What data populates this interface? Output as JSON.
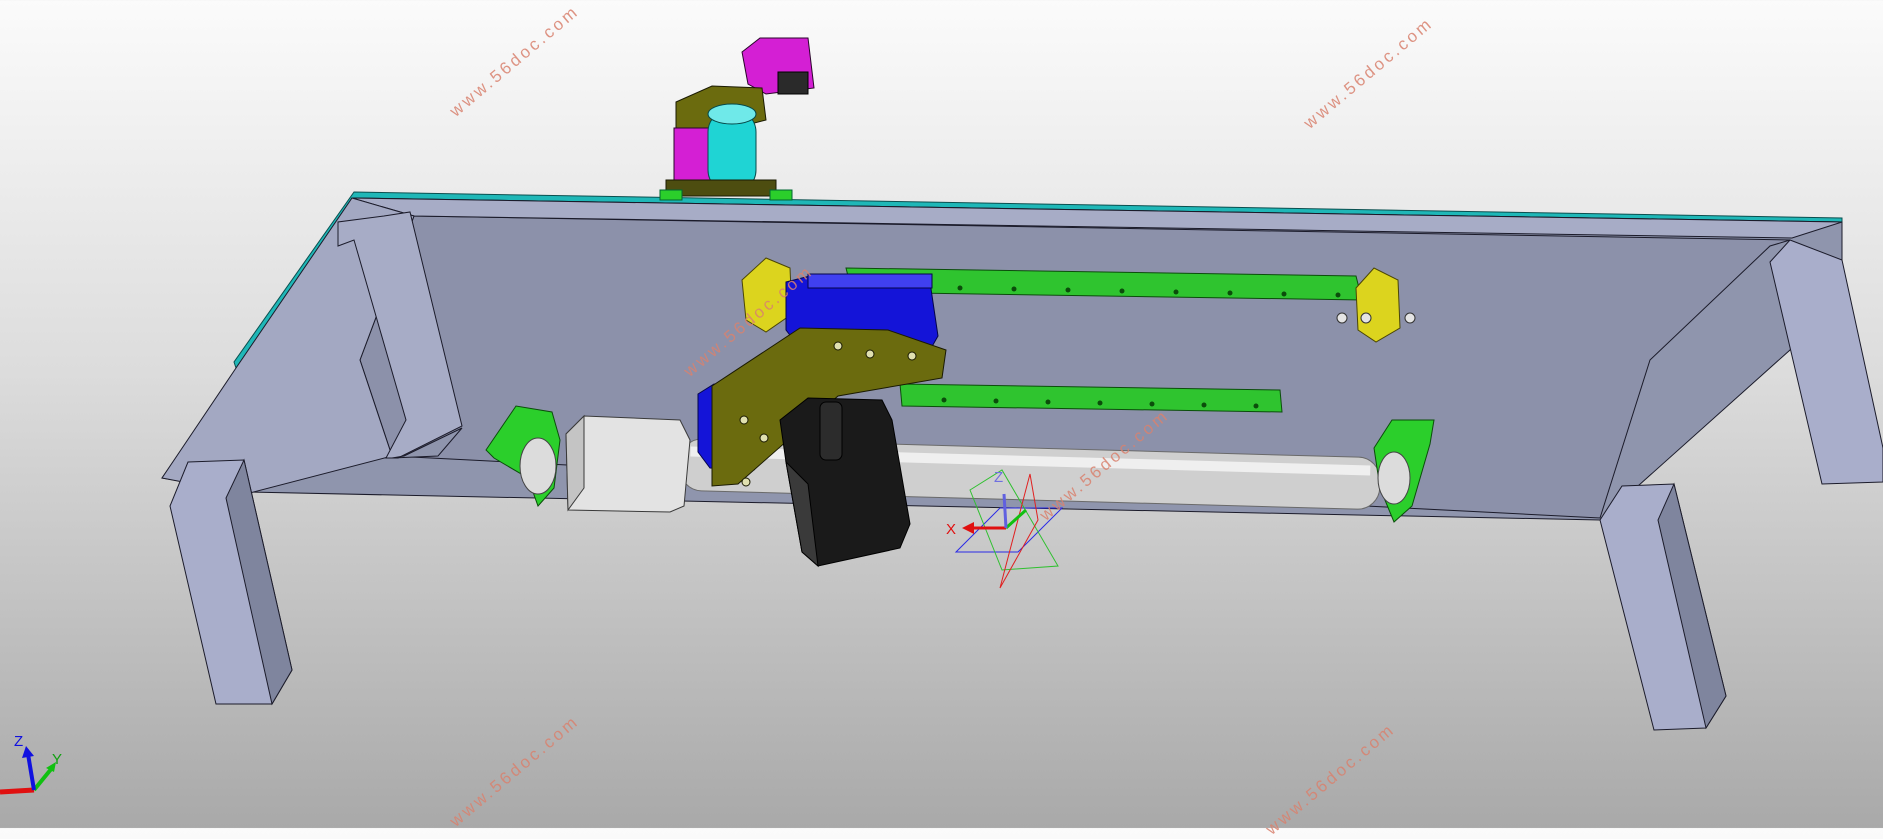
{
  "viewport": {
    "name": "cad-3d-viewport",
    "background_top": "#fbfbfb",
    "background_bottom": "#a9a9a9"
  },
  "watermarks": [
    {
      "text": "www.56doc.com"
    },
    {
      "text": "www.56doc.com"
    },
    {
      "text": "www.56doc.com"
    },
    {
      "text": "www.56doc.com"
    },
    {
      "text": "www.56doc.com"
    },
    {
      "text": "www.56doc.com"
    }
  ],
  "triad": {
    "x_label": "X",
    "y_label": "Y",
    "z_label": "Z"
  },
  "model_axes": {
    "x_label": "X",
    "z_label": "Z"
  },
  "colors": {
    "frame": "#8f95ad",
    "frame_light": "#aab0c9",
    "top_plate": "#1fb7b7",
    "rail": "#2fc42f",
    "end_block": "#dcd41e",
    "carriage": "#1414d8",
    "mount_plate": "#6b6b0e",
    "motor": "#1a1a1a",
    "screw": "#cfcfcf",
    "bracket": "#2bcf2b",
    "magenta": "#d41fd4",
    "cyan": "#1fd4d4",
    "axis_x": "#e01010",
    "axis_y": "#10c010",
    "axis_z": "#1010e0"
  }
}
